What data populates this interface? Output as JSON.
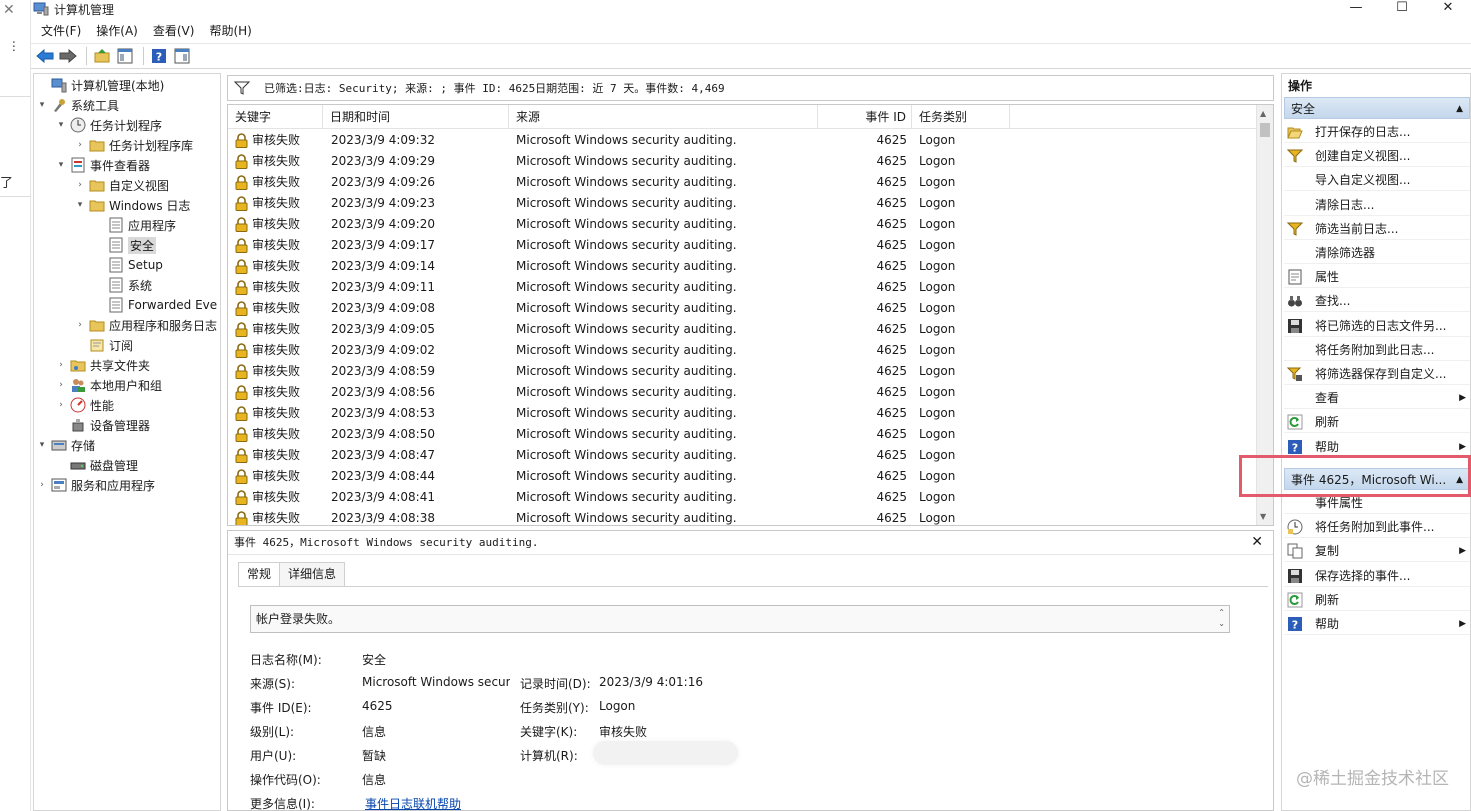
{
  "window": {
    "title": "计算机管理",
    "minimize": "—",
    "maximize": "☐",
    "close": "✕"
  },
  "menu": [
    "文件(F)",
    "操作(A)",
    "查看(V)",
    "帮助(H)"
  ],
  "tree": [
    {
      "label": "计算机管理(本地)",
      "arrow": "",
      "icon": "computer-management-icon"
    },
    {
      "label": "系统工具",
      "arrow": "▾",
      "icon": "tools-icon"
    },
    {
      "label": "任务计划程序",
      "arrow": "▾",
      "icon": "clock-icon"
    },
    {
      "label": "任务计划程序库",
      "arrow": "›",
      "icon": "folder-icon"
    },
    {
      "label": "事件查看器",
      "arrow": "▾",
      "icon": "event-viewer-icon"
    },
    {
      "label": "自定义视图",
      "arrow": "›",
      "icon": "folder-icon"
    },
    {
      "label": "Windows 日志",
      "arrow": "▾",
      "icon": "folder-icon"
    },
    {
      "label": "应用程序",
      "arrow": "",
      "icon": "log-icon"
    },
    {
      "label": "安全",
      "arrow": "",
      "icon": "log-icon"
    },
    {
      "label": "Setup",
      "arrow": "",
      "icon": "log-icon"
    },
    {
      "label": "系统",
      "arrow": "",
      "icon": "log-icon"
    },
    {
      "label": "Forwarded Eve",
      "arrow": "",
      "icon": "log-icon"
    },
    {
      "label": "应用程序和服务日志",
      "arrow": "›",
      "icon": "folder-icon"
    },
    {
      "label": "订阅",
      "arrow": "",
      "icon": "subscription-icon"
    },
    {
      "label": "共享文件夹",
      "arrow": "›",
      "icon": "shared-folder-icon"
    },
    {
      "label": "本地用户和组",
      "arrow": "›",
      "icon": "users-icon"
    },
    {
      "label": "性能",
      "arrow": "›",
      "icon": "performance-icon"
    },
    {
      "label": "设备管理器",
      "arrow": "",
      "icon": "device-manager-icon"
    },
    {
      "label": "存储",
      "arrow": "▾",
      "icon": "storage-icon"
    },
    {
      "label": "磁盘管理",
      "arrow": "",
      "icon": "disk-icon"
    },
    {
      "label": "服务和应用程序",
      "arrow": "›",
      "icon": "services-icon"
    }
  ],
  "filter": {
    "text": "已筛选:日志: Security; 来源: ; 事件 ID: 4625日期范围: 近 7 天。事件数: 4,469"
  },
  "list": {
    "columns": [
      "关键字",
      "日期和时间",
      "来源",
      "事件 ID",
      "任务类别"
    ],
    "rows": [
      {
        "keyword": "审核失败",
        "datetime": "2023/3/9 4:09:32",
        "source": "Microsoft Windows security auditing.",
        "event_id": "4625",
        "category": "Logon"
      },
      {
        "keyword": "审核失败",
        "datetime": "2023/3/9 4:09:29",
        "source": "Microsoft Windows security auditing.",
        "event_id": "4625",
        "category": "Logon"
      },
      {
        "keyword": "审核失败",
        "datetime": "2023/3/9 4:09:26",
        "source": "Microsoft Windows security auditing.",
        "event_id": "4625",
        "category": "Logon"
      },
      {
        "keyword": "审核失败",
        "datetime": "2023/3/9 4:09:23",
        "source": "Microsoft Windows security auditing.",
        "event_id": "4625",
        "category": "Logon"
      },
      {
        "keyword": "审核失败",
        "datetime": "2023/3/9 4:09:20",
        "source": "Microsoft Windows security auditing.",
        "event_id": "4625",
        "category": "Logon"
      },
      {
        "keyword": "审核失败",
        "datetime": "2023/3/9 4:09:17",
        "source": "Microsoft Windows security auditing.",
        "event_id": "4625",
        "category": "Logon"
      },
      {
        "keyword": "审核失败",
        "datetime": "2023/3/9 4:09:14",
        "source": "Microsoft Windows security auditing.",
        "event_id": "4625",
        "category": "Logon"
      },
      {
        "keyword": "审核失败",
        "datetime": "2023/3/9 4:09:11",
        "source": "Microsoft Windows security auditing.",
        "event_id": "4625",
        "category": "Logon"
      },
      {
        "keyword": "审核失败",
        "datetime": "2023/3/9 4:09:08",
        "source": "Microsoft Windows security auditing.",
        "event_id": "4625",
        "category": "Logon"
      },
      {
        "keyword": "审核失败",
        "datetime": "2023/3/9 4:09:05",
        "source": "Microsoft Windows security auditing.",
        "event_id": "4625",
        "category": "Logon"
      },
      {
        "keyword": "审核失败",
        "datetime": "2023/3/9 4:09:02",
        "source": "Microsoft Windows security auditing.",
        "event_id": "4625",
        "category": "Logon"
      },
      {
        "keyword": "审核失败",
        "datetime": "2023/3/9 4:08:59",
        "source": "Microsoft Windows security auditing.",
        "event_id": "4625",
        "category": "Logon"
      },
      {
        "keyword": "审核失败",
        "datetime": "2023/3/9 4:08:56",
        "source": "Microsoft Windows security auditing.",
        "event_id": "4625",
        "category": "Logon"
      },
      {
        "keyword": "审核失败",
        "datetime": "2023/3/9 4:08:53",
        "source": "Microsoft Windows security auditing.",
        "event_id": "4625",
        "category": "Logon"
      },
      {
        "keyword": "审核失败",
        "datetime": "2023/3/9 4:08:50",
        "source": "Microsoft Windows security auditing.",
        "event_id": "4625",
        "category": "Logon"
      },
      {
        "keyword": "审核失败",
        "datetime": "2023/3/9 4:08:47",
        "source": "Microsoft Windows security auditing.",
        "event_id": "4625",
        "category": "Logon"
      },
      {
        "keyword": "审核失败",
        "datetime": "2023/3/9 4:08:44",
        "source": "Microsoft Windows security auditing.",
        "event_id": "4625",
        "category": "Logon"
      },
      {
        "keyword": "审核失败",
        "datetime": "2023/3/9 4:08:41",
        "source": "Microsoft Windows security auditing.",
        "event_id": "4625",
        "category": "Logon"
      },
      {
        "keyword": "审核失败",
        "datetime": "2023/3/9 4:08:38",
        "source": "Microsoft Windows security auditing.",
        "event_id": "4625",
        "category": "Logon"
      }
    ]
  },
  "detail": {
    "header": "事件 4625，Microsoft Windows security auditing.",
    "close": "✕",
    "tabs": [
      "常规",
      "详细信息"
    ],
    "description": "帐户登录失败。",
    "fields": {
      "log_name_label": "日志名称(M):",
      "log_name": "安全",
      "source_label": "来源(S):",
      "source": "Microsoft Windows security auditing.",
      "logged_label": "记录时间(D):",
      "logged": "2023/3/9 4:01:16",
      "event_id_label": "事件 ID(E):",
      "event_id": "4625",
      "task_label": "任务类别(Y):",
      "task": "Logon",
      "level_label": "级别(L):",
      "level": "信息",
      "keywords_label": "关键字(K):",
      "keywords": "审核失败",
      "user_label": "用户(U):",
      "user": "暂缺",
      "computer_label": "计算机(R):",
      "opcode_label": "操作代码(O):",
      "opcode": "信息",
      "more_info_label": "更多信息(I):",
      "more_info": "事件日志联机帮助"
    }
  },
  "actions": {
    "title": "操作",
    "section1": "安全",
    "items1": [
      {
        "label": "打开保存的日志...",
        "icon": "open-folder-icon",
        "submenu": false
      },
      {
        "label": "创建自定义视图...",
        "icon": "filter-icon",
        "submenu": false
      },
      {
        "label": "导入自定义视图...",
        "icon": "",
        "submenu": false
      },
      {
        "label": "清除日志...",
        "icon": "",
        "submenu": false
      },
      {
        "label": "筛选当前日志...",
        "icon": "filter-icon",
        "submenu": false
      },
      {
        "label": "清除筛选器",
        "icon": "",
        "submenu": false
      },
      {
        "label": "属性",
        "icon": "properties-icon",
        "submenu": false
      },
      {
        "label": "查找...",
        "icon": "binoculars-icon",
        "submenu": false
      },
      {
        "label": "将已筛选的日志文件另...",
        "icon": "save-icon",
        "submenu": false
      },
      {
        "label": "将任务附加到此日志...",
        "icon": "",
        "submenu": false
      },
      {
        "label": "将筛选器保存到自定义...",
        "icon": "filter-save-icon",
        "submenu": false
      },
      {
        "label": "查看",
        "icon": "",
        "submenu": true
      },
      {
        "label": "刷新",
        "icon": "refresh-icon",
        "submenu": false
      },
      {
        "label": "帮助",
        "icon": "help-icon",
        "submenu": true
      }
    ],
    "section2": "事件 4625，Microsoft Wi...",
    "items2": [
      {
        "label": "事件属性",
        "icon": "",
        "submenu": false
      },
      {
        "label": "将任务附加到此事件...",
        "icon": "task-icon",
        "submenu": false
      },
      {
        "label": "复制",
        "icon": "copy-icon",
        "submenu": true
      },
      {
        "label": "保存选择的事件...",
        "icon": "save-icon",
        "submenu": false
      },
      {
        "label": "刷新",
        "icon": "refresh-icon",
        "submenu": false
      },
      {
        "label": "帮助",
        "icon": "help-icon",
        "submenu": true
      }
    ]
  },
  "background_window": {
    "close": "✕",
    "dots": "···",
    "fragment": "了"
  },
  "watermark": "@稀土掘金技术社区",
  "colors": {
    "accent": "#1e6fc9",
    "highlight_box": "#e35a6a",
    "section_bg": "#c4d7ec"
  }
}
